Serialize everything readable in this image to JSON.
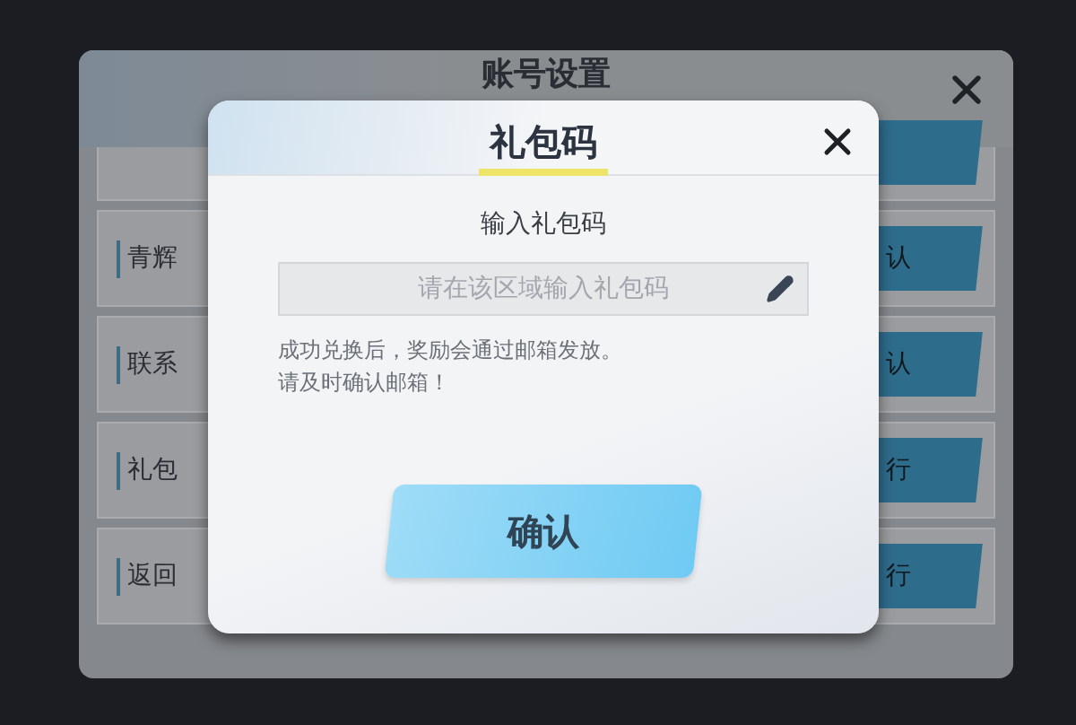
{
  "background_panel": {
    "title": "账号设置",
    "rows": [
      {
        "button": ""
      },
      {
        "label": "青辉",
        "button": "认"
      },
      {
        "label": "联系",
        "button": "认"
      },
      {
        "label": "礼包",
        "button": "行"
      },
      {
        "label": "返回",
        "button": "行"
      }
    ]
  },
  "dialog": {
    "title": "礼包码",
    "subtitle": "输入礼包码",
    "field": {
      "placeholder": "请在该区域输入礼包码"
    },
    "notes": [
      "成功兑换后，奖励会通过邮箱发放。",
      "请及时确认邮箱！"
    ],
    "button": "确认"
  }
}
